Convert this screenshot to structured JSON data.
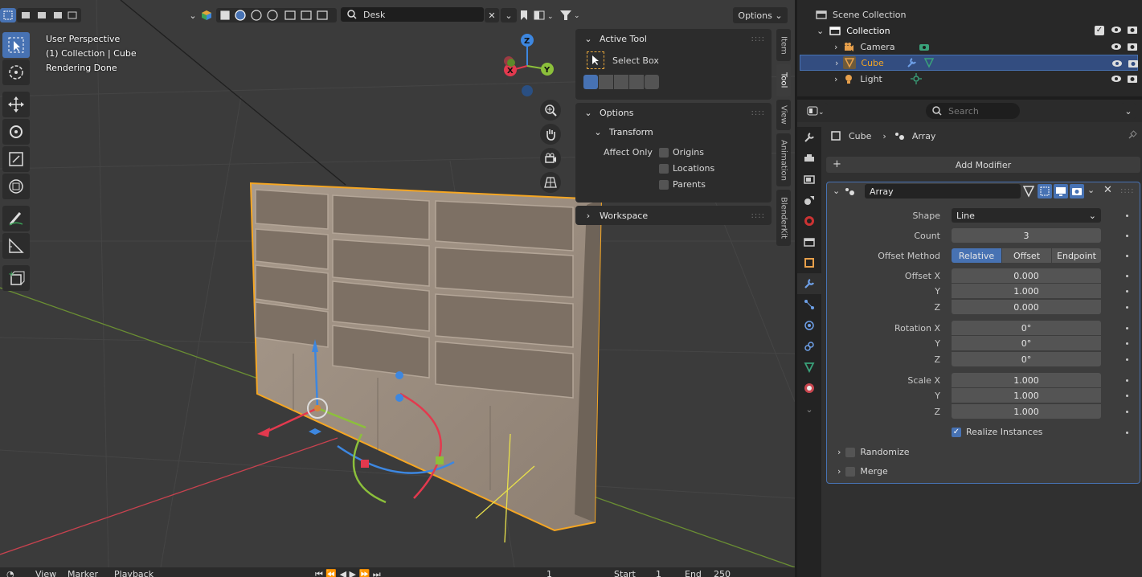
{
  "viewport": {
    "overlay": {
      "line1": "User Perspective",
      "line2": "(1) Collection | Cube",
      "line3": "Rendering Done"
    },
    "header": {
      "search_value": "Desk",
      "options_label": "Options"
    },
    "gizmo": {
      "z": "Z",
      "x": "X",
      "y": "Y"
    }
  },
  "npanel": {
    "active_tool": {
      "title": "Active Tool",
      "tool_name": "Select Box"
    },
    "options": {
      "title": "Options",
      "transform_title": "Transform",
      "affect_only_label": "Affect Only",
      "origins": "Origins",
      "locations": "Locations",
      "parents": "Parents"
    },
    "workspace": {
      "title": "Workspace"
    },
    "tabs": [
      "Item",
      "Tool",
      "View",
      "Animation",
      "BlenderKit"
    ]
  },
  "timeline": {
    "view": "View",
    "marker": "Marker",
    "playback": "Playback",
    "current_frame": "1",
    "start_label": "Start",
    "start_value": "1",
    "end_label": "End",
    "end_value": "250"
  },
  "outliner": {
    "scene_collection": "Scene Collection",
    "collection": "Collection",
    "items": [
      {
        "name": "Camera"
      },
      {
        "name": "Cube"
      },
      {
        "name": "Light"
      }
    ]
  },
  "properties": {
    "search_placeholder": "Search",
    "breadcrumb_object": "Cube",
    "breadcrumb_modifier": "Array",
    "add_modifier": "Add Modifier",
    "modifier": {
      "name": "Array",
      "shape_label": "Shape",
      "shape_value": "Line",
      "count_label": "Count",
      "count_value": "3",
      "offset_method_label": "Offset Method",
      "offset_methods": [
        "Relative",
        "Offset",
        "Endpoint"
      ],
      "offset_x_label": "Offset X",
      "offset_x": "0.000",
      "offset_y": "1.000",
      "offset_z": "0.000",
      "rotation_x_label": "Rotation X",
      "rotation_x": "0°",
      "rotation_y": "0°",
      "rotation_z": "0°",
      "scale_x_label": "Scale X",
      "scale_x": "1.000",
      "scale_y": "1.000",
      "scale_z": "1.000",
      "y_label": "Y",
      "z_label": "Z",
      "realize_instances": "Realize Instances",
      "randomize": "Randomize",
      "merge": "Merge"
    }
  },
  "colors": {
    "accent": "#4772b3",
    "selection_orange": "#f5a623",
    "axis_x": "#e3394e",
    "axis_y": "#8cc03b",
    "axis_z": "#3d87e0"
  }
}
